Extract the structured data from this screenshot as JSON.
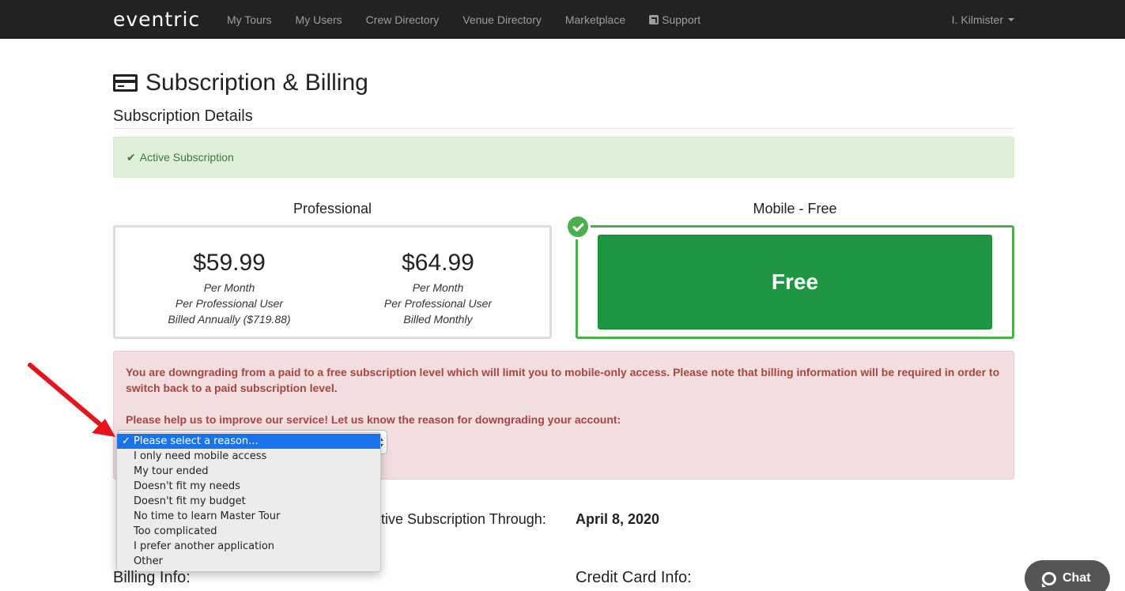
{
  "nav": {
    "brand": "eventric",
    "links": [
      "My Tours",
      "My Users",
      "Crew Directory",
      "Venue Directory",
      "Marketplace",
      "Support"
    ],
    "user": "I. Kilmister"
  },
  "page": {
    "title": "Subscription & Billing",
    "section": "Subscription Details"
  },
  "active_alert": "Active Subscription",
  "plans": {
    "professional": {
      "label": "Professional",
      "annual": {
        "price": "$59.99",
        "line1": "Per Month",
        "line2": "Per Professional User",
        "line3": "Billed Annually ($719.88)"
      },
      "monthly": {
        "price": "$64.99",
        "line1": "Per Month",
        "line2": "Per Professional User",
        "line3": "Billed Monthly"
      }
    },
    "mobile": {
      "label": "Mobile - Free",
      "button": "Free"
    }
  },
  "downgrade": {
    "message": "You are downgrading from a paid to a free subscription level which will limit you to mobile-only access. Please note that billing information will be required in order to switch back to a paid subscription level.",
    "ask": "Please help us to improve our service! Let us know the reason for downgrading your account:",
    "selected_index": 0,
    "options": [
      "Please select a reason...",
      "I only need mobile access",
      "My tour ended",
      "Doesn't fit my needs",
      "Doesn't fit my budget",
      "No time to learn Master Tour",
      "Too complicated",
      "I prefer another application",
      "Other"
    ]
  },
  "subscription_through": {
    "label": "tive Subscription Through:",
    "date": "April 8, 2020"
  },
  "billing_heading": "Billing Info:",
  "cc_heading": "Credit Card Info:",
  "chat": "Chat",
  "colors": {
    "free_green": "#1e9642",
    "selected_blue": "#1a73e8",
    "arrow_red": "#e8141b"
  }
}
